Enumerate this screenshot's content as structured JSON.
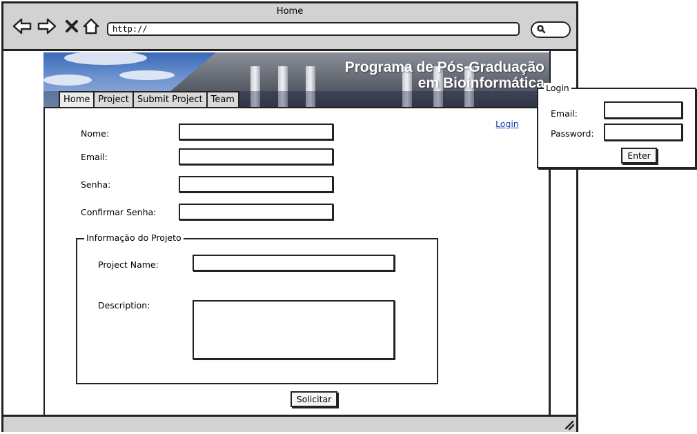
{
  "window": {
    "title": "Home"
  },
  "browser": {
    "url": "http://",
    "icons": [
      "back-arrow-icon",
      "forward-arrow-icon",
      "close-x-icon",
      "home-icon",
      "search-icon",
      "resize-grip-icon"
    ]
  },
  "banner": {
    "title_line1": "Programa de Pós-Graduação",
    "title_line2": "em Bioinformática"
  },
  "tabs": [
    {
      "label": "Home"
    },
    {
      "label": "Project"
    },
    {
      "label": "Submit Project"
    },
    {
      "label": "Team"
    }
  ],
  "form": {
    "login_link": "Login",
    "nome_label": "Nome:",
    "email_label": "Email:",
    "senha_label": "Senha:",
    "confirmar_label": "Confirmar Senha:",
    "nome_value": "",
    "email_value": "",
    "senha_value": "",
    "confirmar_value": "",
    "project_section": {
      "legend": "Informação do Projeto",
      "name_label": "Project Name:",
      "description_label": "Description:",
      "name_value": "",
      "description_value": ""
    },
    "submit_label": "Solicitar"
  },
  "login_panel": {
    "legend": "Login",
    "email_label": "Email:",
    "password_label": "Password:",
    "email_value": "",
    "password_value": "",
    "enter_label": "Enter"
  }
}
